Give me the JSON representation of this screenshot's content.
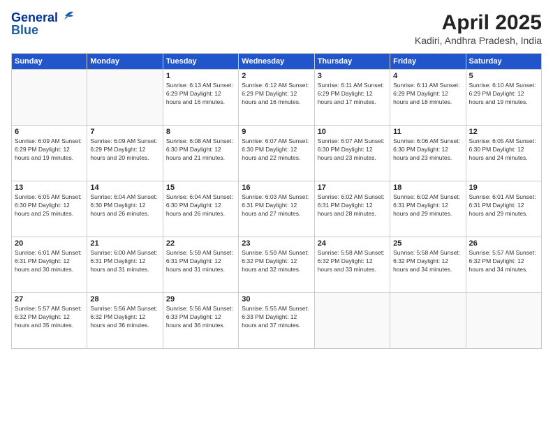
{
  "logo": {
    "line1": "General",
    "line2": "Blue"
  },
  "title": "April 2025",
  "location": "Kadiri, Andhra Pradesh, India",
  "weekdays": [
    "Sunday",
    "Monday",
    "Tuesday",
    "Wednesday",
    "Thursday",
    "Friday",
    "Saturday"
  ],
  "weeks": [
    [
      {
        "day": "",
        "info": ""
      },
      {
        "day": "",
        "info": ""
      },
      {
        "day": "1",
        "info": "Sunrise: 6:13 AM\nSunset: 6:29 PM\nDaylight: 12 hours and 16 minutes."
      },
      {
        "day": "2",
        "info": "Sunrise: 6:12 AM\nSunset: 6:29 PM\nDaylight: 12 hours and 16 minutes."
      },
      {
        "day": "3",
        "info": "Sunrise: 6:11 AM\nSunset: 6:29 PM\nDaylight: 12 hours and 17 minutes."
      },
      {
        "day": "4",
        "info": "Sunrise: 6:11 AM\nSunset: 6:29 PM\nDaylight: 12 hours and 18 minutes."
      },
      {
        "day": "5",
        "info": "Sunrise: 6:10 AM\nSunset: 6:29 PM\nDaylight: 12 hours and 19 minutes."
      }
    ],
    [
      {
        "day": "6",
        "info": "Sunrise: 6:09 AM\nSunset: 6:29 PM\nDaylight: 12 hours and 19 minutes."
      },
      {
        "day": "7",
        "info": "Sunrise: 6:09 AM\nSunset: 6:29 PM\nDaylight: 12 hours and 20 minutes."
      },
      {
        "day": "8",
        "info": "Sunrise: 6:08 AM\nSunset: 6:30 PM\nDaylight: 12 hours and 21 minutes."
      },
      {
        "day": "9",
        "info": "Sunrise: 6:07 AM\nSunset: 6:30 PM\nDaylight: 12 hours and 22 minutes."
      },
      {
        "day": "10",
        "info": "Sunrise: 6:07 AM\nSunset: 6:30 PM\nDaylight: 12 hours and 23 minutes."
      },
      {
        "day": "11",
        "info": "Sunrise: 6:06 AM\nSunset: 6:30 PM\nDaylight: 12 hours and 23 minutes."
      },
      {
        "day": "12",
        "info": "Sunrise: 6:05 AM\nSunset: 6:30 PM\nDaylight: 12 hours and 24 minutes."
      }
    ],
    [
      {
        "day": "13",
        "info": "Sunrise: 6:05 AM\nSunset: 6:30 PM\nDaylight: 12 hours and 25 minutes."
      },
      {
        "day": "14",
        "info": "Sunrise: 6:04 AM\nSunset: 6:30 PM\nDaylight: 12 hours and 26 minutes."
      },
      {
        "day": "15",
        "info": "Sunrise: 6:04 AM\nSunset: 6:30 PM\nDaylight: 12 hours and 26 minutes."
      },
      {
        "day": "16",
        "info": "Sunrise: 6:03 AM\nSunset: 6:31 PM\nDaylight: 12 hours and 27 minutes."
      },
      {
        "day": "17",
        "info": "Sunrise: 6:02 AM\nSunset: 6:31 PM\nDaylight: 12 hours and 28 minutes."
      },
      {
        "day": "18",
        "info": "Sunrise: 6:02 AM\nSunset: 6:31 PM\nDaylight: 12 hours and 29 minutes."
      },
      {
        "day": "19",
        "info": "Sunrise: 6:01 AM\nSunset: 6:31 PM\nDaylight: 12 hours and 29 minutes."
      }
    ],
    [
      {
        "day": "20",
        "info": "Sunrise: 6:01 AM\nSunset: 6:31 PM\nDaylight: 12 hours and 30 minutes."
      },
      {
        "day": "21",
        "info": "Sunrise: 6:00 AM\nSunset: 6:31 PM\nDaylight: 12 hours and 31 minutes."
      },
      {
        "day": "22",
        "info": "Sunrise: 5:59 AM\nSunset: 6:31 PM\nDaylight: 12 hours and 31 minutes."
      },
      {
        "day": "23",
        "info": "Sunrise: 5:59 AM\nSunset: 6:32 PM\nDaylight: 12 hours and 32 minutes."
      },
      {
        "day": "24",
        "info": "Sunrise: 5:58 AM\nSunset: 6:32 PM\nDaylight: 12 hours and 33 minutes."
      },
      {
        "day": "25",
        "info": "Sunrise: 5:58 AM\nSunset: 6:32 PM\nDaylight: 12 hours and 34 minutes."
      },
      {
        "day": "26",
        "info": "Sunrise: 5:57 AM\nSunset: 6:32 PM\nDaylight: 12 hours and 34 minutes."
      }
    ],
    [
      {
        "day": "27",
        "info": "Sunrise: 5:57 AM\nSunset: 6:32 PM\nDaylight: 12 hours and 35 minutes."
      },
      {
        "day": "28",
        "info": "Sunrise: 5:56 AM\nSunset: 6:32 PM\nDaylight: 12 hours and 36 minutes."
      },
      {
        "day": "29",
        "info": "Sunrise: 5:56 AM\nSunset: 6:33 PM\nDaylight: 12 hours and 36 minutes."
      },
      {
        "day": "30",
        "info": "Sunrise: 5:55 AM\nSunset: 6:33 PM\nDaylight: 12 hours and 37 minutes."
      },
      {
        "day": "",
        "info": ""
      },
      {
        "day": "",
        "info": ""
      },
      {
        "day": "",
        "info": ""
      }
    ]
  ]
}
